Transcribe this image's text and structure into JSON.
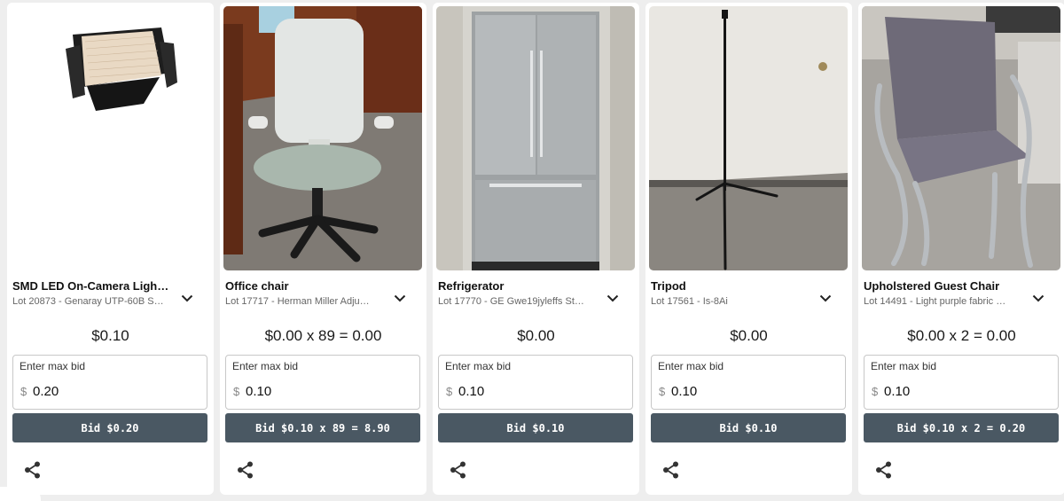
{
  "bid_label_placeholder": "Enter max bid",
  "currency_symbol": "$",
  "colors": {
    "bid_button": "#4a5863",
    "card": "#ffffff",
    "page": "#eeeeee"
  },
  "lots": [
    {
      "title": "SMD LED On-Camera Light …",
      "subtitle": "Lot 20873 - Genaray UTP-60B S…",
      "price": "$0.10",
      "max_bid_label": "Enter max bid",
      "bid_value": "0.20",
      "bid_button": "Bid $0.20"
    },
    {
      "title": "Office chair",
      "subtitle": "Lot 17717 - Herman Miller Adju…",
      "price": "$0.00 x 89 = 0.00",
      "max_bid_label": "Enter max bid",
      "bid_value": "0.10",
      "bid_button": "Bid $0.10 x 89 = 8.90"
    },
    {
      "title": "Refrigerator",
      "subtitle": "Lot 17770 - GE Gwe19jyleffs St…",
      "price": "$0.00",
      "max_bid_label": "Enter max bid",
      "bid_value": "0.10",
      "bid_button": "Bid $0.10"
    },
    {
      "title": "Tripod",
      "subtitle": "Lot 17561 - Is-8Ai",
      "price": "$0.00",
      "max_bid_label": "Enter max bid",
      "bid_value": "0.10",
      "bid_button": "Bid $0.10"
    },
    {
      "title": "Upholstered Guest Chair",
      "subtitle": "Lot 14491 - Light purple fabric …",
      "price": "$0.00 x 2 = 0.00",
      "max_bid_label": "Enter max bid",
      "bid_value": "0.10",
      "bid_button": "Bid $0.10 x 2 = 0.20"
    }
  ]
}
